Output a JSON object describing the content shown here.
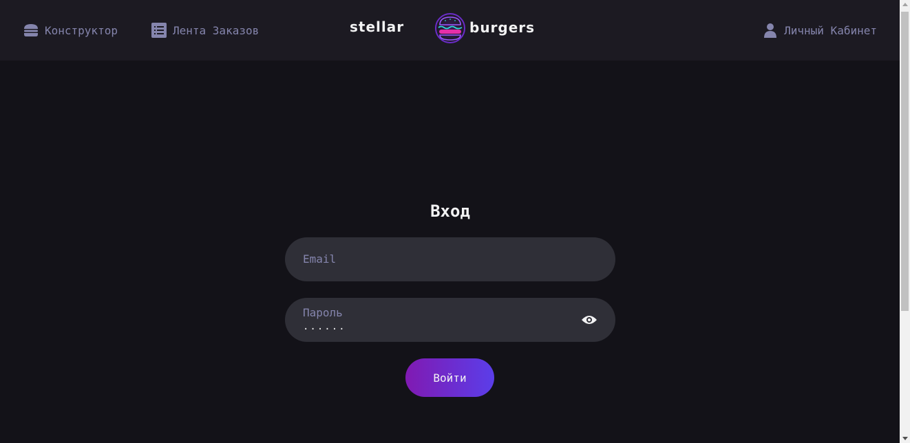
{
  "header": {
    "nav": {
      "constructor_label": "Конструктор",
      "feed_label": "Лента Заказов",
      "account_label": "Личный Кабинет"
    },
    "logo": {
      "left_text": "stellar",
      "right_text": "burgers"
    }
  },
  "form": {
    "title": "Вход",
    "email": {
      "placeholder": "Email",
      "value": ""
    },
    "password": {
      "label": "Пароль",
      "value": "......"
    },
    "submit_label": "Войти"
  },
  "colors": {
    "background": "#131218",
    "header": "#1c1a22",
    "field": "#2f2f37",
    "muted_text": "#8585ad",
    "accent": "#801ab2"
  },
  "icons": {
    "constructor": "burger-icon",
    "feed": "list-icon",
    "account": "profile-icon",
    "password_toggle": "eye-icon"
  }
}
